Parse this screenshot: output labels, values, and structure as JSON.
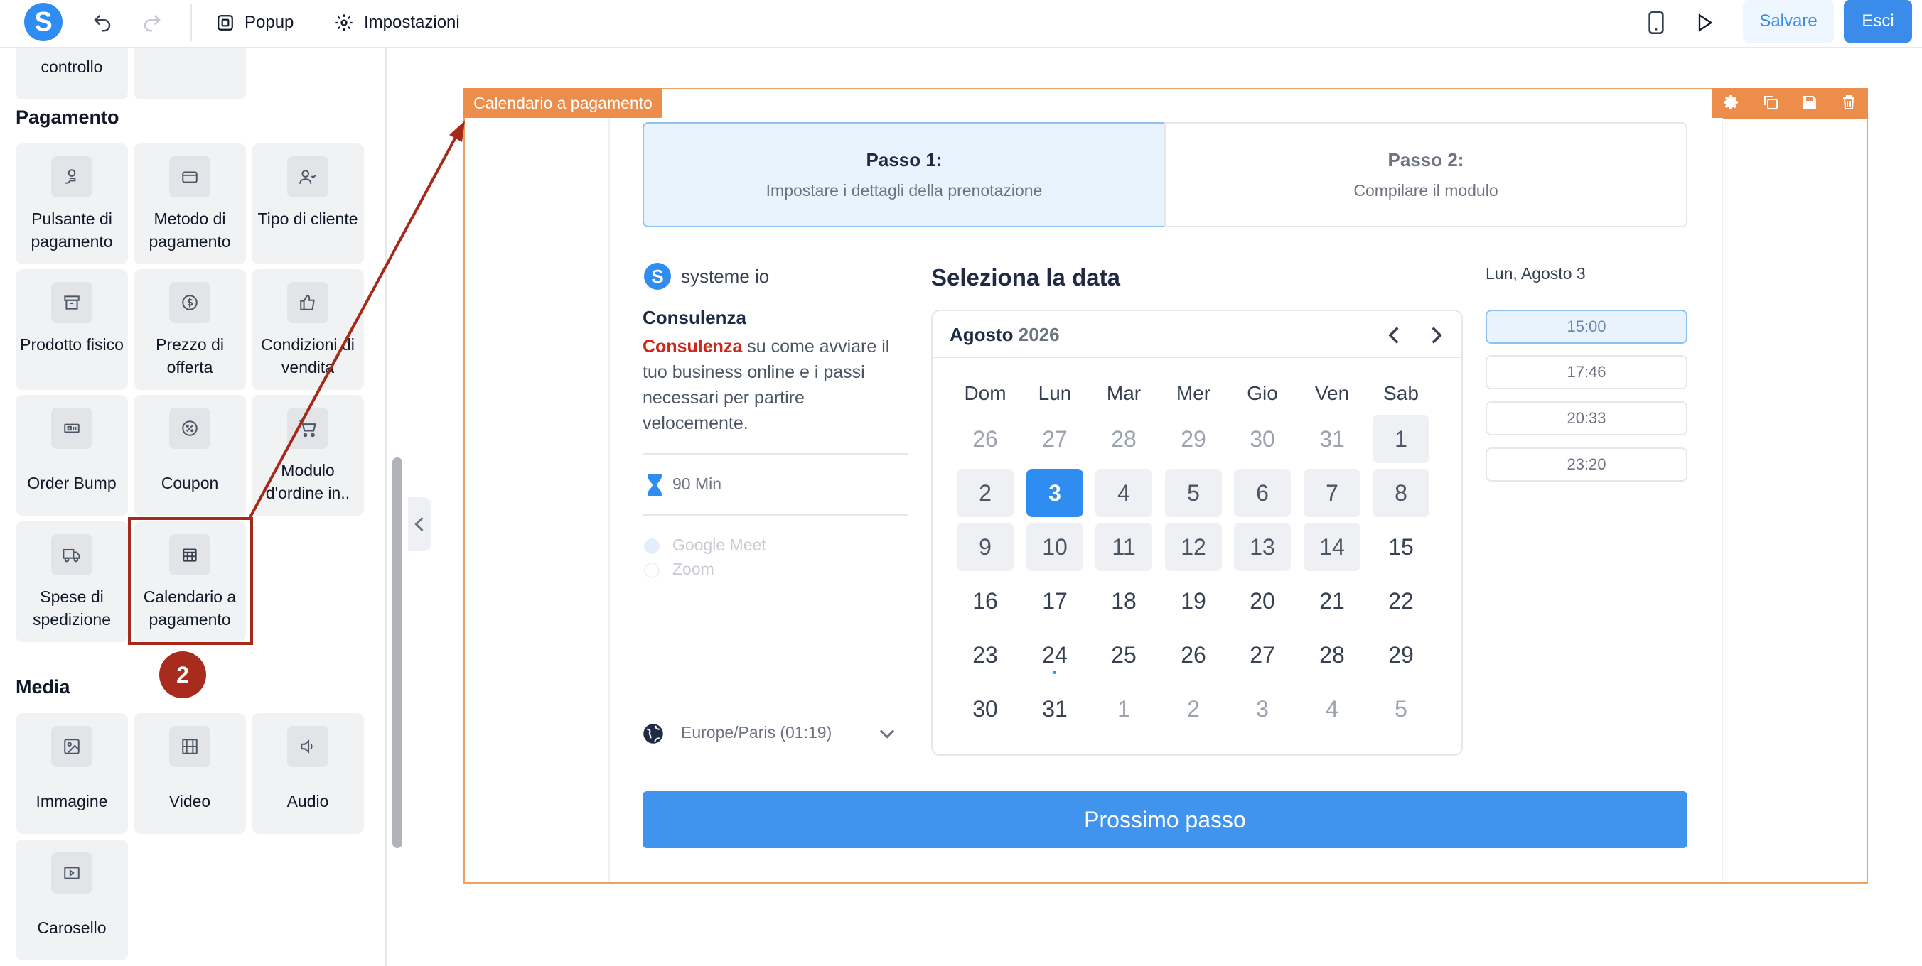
{
  "topbar": {
    "popup_label": "Popup",
    "settings_label": "Impostazioni",
    "save_label": "Salvare",
    "exit_label": "Esci",
    "logo_letter": "S"
  },
  "sidebar": {
    "partial_label": "controllo",
    "section_payment": "Pagamento",
    "section_media": "Media",
    "payment_items": [
      {
        "label": "Pulsante di pagamento",
        "icon": "payment-hand-icon"
      },
      {
        "label": "Metodo di pagamento",
        "icon": "credit-card-icon"
      },
      {
        "label": "Tipo di cliente",
        "icon": "users-icon"
      },
      {
        "label": "Prodotto fisico",
        "icon": "box-icon"
      },
      {
        "label": "Prezzo di offerta",
        "icon": "dollar-coin-icon"
      },
      {
        "label": "Condizioni di vendita",
        "icon": "thumbs-up-icon"
      },
      {
        "label": "Order Bump",
        "icon": "ticket-icon"
      },
      {
        "label": "Coupon",
        "icon": "discount-icon"
      },
      {
        "label": "Modulo d'ordine in..",
        "icon": "cart-icon"
      },
      {
        "label": "Spese di spedizione",
        "icon": "truck-icon"
      },
      {
        "label": "Calendario a pagamento",
        "icon": "calendar-icon"
      }
    ],
    "media_items": [
      {
        "label": "Immagine",
        "icon": "image-icon"
      },
      {
        "label": "Video",
        "icon": "film-icon"
      },
      {
        "label": "Audio",
        "icon": "speaker-icon"
      },
      {
        "label": "Carosello",
        "icon": "carousel-icon"
      }
    ],
    "annotation_badge": "2"
  },
  "canvas": {
    "element_tag": "Calendario a pagamento",
    "steps": [
      {
        "title": "Passo 1:",
        "subtitle": "Impostare i dettagli della prenotazione"
      },
      {
        "title": "Passo 2:",
        "subtitle": "Compilare il modulo"
      }
    ],
    "brand": "systeme io",
    "service_title": "Consulenza",
    "service_desc_highlight": "Consulenza",
    "service_desc_rest": " su come avviare il tuo business online e i passi necessari per partire velocemente.",
    "duration": "90 Min",
    "locations": [
      "Google Meet",
      "Zoom"
    ],
    "timezone": "Europe/Paris (01:19)",
    "calendar_title": "Seleziona la data",
    "month": "Agosto",
    "year": "2026",
    "weekdays": [
      "Dom",
      "Lun",
      "Mar",
      "Mer",
      "Gio",
      "Ven",
      "Sab"
    ],
    "weeks": [
      [
        "26",
        "27",
        "28",
        "29",
        "30",
        "31",
        "1"
      ],
      [
        "2",
        "3",
        "4",
        "5",
        "6",
        "7",
        "8"
      ],
      [
        "9",
        "10",
        "11",
        "12",
        "13",
        "14",
        "15"
      ],
      [
        "16",
        "17",
        "18",
        "19",
        "20",
        "21",
        "22"
      ],
      [
        "23",
        "24",
        "25",
        "26",
        "27",
        "28",
        "29"
      ],
      [
        "30",
        "31",
        "1",
        "2",
        "3",
        "4",
        "5"
      ]
    ],
    "selected_date_label": "Lun, Agosto 3",
    "time_slots": [
      "15:00",
      "17:46",
      "20:33",
      "23:20"
    ],
    "next_button": "Prossimo passo",
    "colors": {
      "accent": "#2f8cf0",
      "frame": "#ec8d4c",
      "annotation": "#a52a1a",
      "highlight_text": "#d0261b"
    }
  }
}
